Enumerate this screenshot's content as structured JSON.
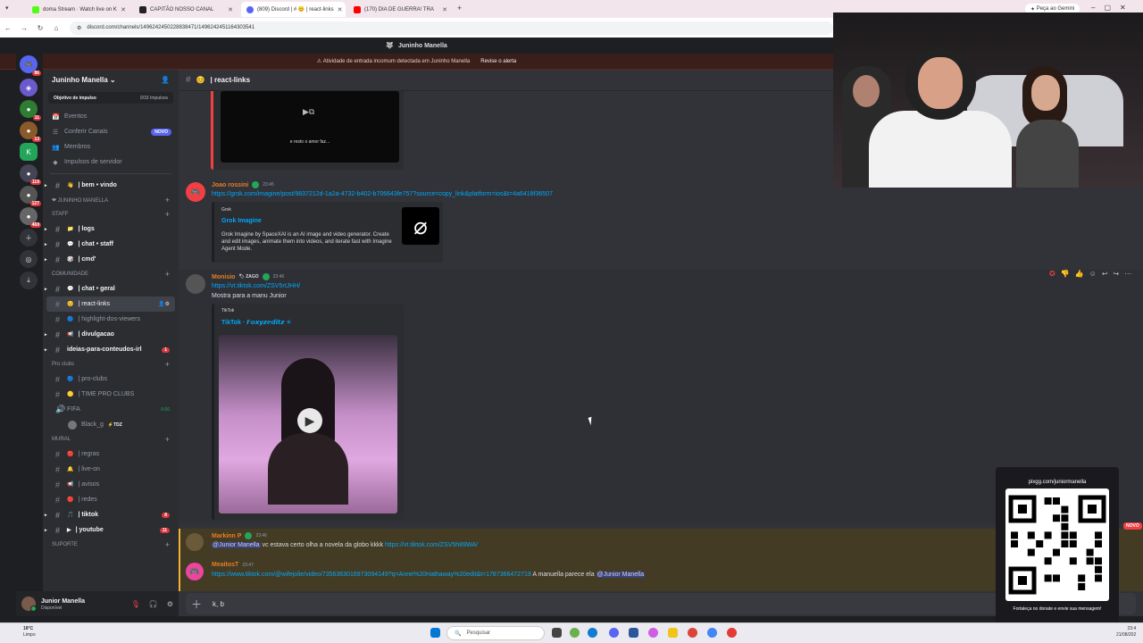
{
  "browser": {
    "tabs": [
      {
        "label": "doma Stream · Watch live on K",
        "active": false,
        "color": "#53fc18"
      },
      {
        "label": "CAPITÃO NOSSO CANAL",
        "active": false,
        "color": "#222222"
      },
      {
        "label": "(809) Discord | # 😊 | react-links",
        "active": true,
        "color": "#5865f2"
      },
      {
        "label": "(170) DIA DE GUERRA! TRA",
        "active": false,
        "color": "#ff0000"
      }
    ],
    "url": "discord.com/channels/1496242450228838471/1496242451164303541",
    "gemini_label": "Peça ao Gemini"
  },
  "discord": {
    "top_title": "Juninho Manella",
    "alert_text": "Atividade de entrada incomum detectada em Juninho Manella",
    "alert_link": "Revise o alerta",
    "server_badges": [
      "86",
      "11",
      "13",
      "119",
      "127",
      "469"
    ],
    "server_name": "Juninho Manella",
    "boost_label": "Objetivo de impulso",
    "boost_value": "0/33 Impulsos",
    "nav": [
      {
        "icon": "calendar-icon",
        "label": "Eventos"
      },
      {
        "icon": "channels-icon",
        "label": "Conferir Canais",
        "badge": "NOVO"
      },
      {
        "icon": "members-icon",
        "label": "Membros"
      },
      {
        "icon": "boost-icon",
        "label": "Impulsos de servidor"
      }
    ],
    "channel_list": [
      {
        "type": "ch",
        "emoji": "👋",
        "label": "| bem • vindo",
        "bright": true
      },
      {
        "type": "cat",
        "label": "❤ JUNINHO MANELLA"
      },
      {
        "type": "cat",
        "label": "STAFF"
      },
      {
        "type": "ch",
        "emoji": "📁",
        "label": "| logs",
        "bright": true
      },
      {
        "type": "ch",
        "emoji": "💬",
        "label": "| chat • staff",
        "bright": true
      },
      {
        "type": "ch",
        "emoji": "🎲",
        "label": "| cmd'",
        "bright": true
      },
      {
        "type": "cat",
        "label": "COMUNIDADE"
      },
      {
        "type": "ch",
        "emoji": "💬",
        "label": "| chat • geral",
        "bright": true
      },
      {
        "type": "ch",
        "emoji": "😊",
        "label": "| react-links",
        "selected": true
      },
      {
        "type": "ch",
        "emoji": "🔵",
        "label": "| highlight-dos-viewers"
      },
      {
        "type": "ch",
        "emoji": "📢",
        "label": "| divulgacao",
        "bright": true
      },
      {
        "type": "ch",
        "emoji": "",
        "label": "ideias-para-conteudos-irl",
        "bright": true,
        "badge": "1"
      },
      {
        "type": "cat",
        "label": "Pro clubs"
      },
      {
        "type": "ch",
        "emoji": "🔵",
        "label": "| pro-clubs"
      },
      {
        "type": "ch",
        "emoji": "🟡",
        "label": "| TIME PRO CLUBS"
      },
      {
        "type": "voice",
        "emoji": "🔊",
        "label": "FIFA",
        "right": "0:00"
      },
      {
        "type": "user",
        "label": "Black_g",
        "tag": "⚡TDZ"
      },
      {
        "type": "cat",
        "label": "MURAL"
      },
      {
        "type": "ch",
        "emoji": "🔴",
        "label": "| regras"
      },
      {
        "type": "ch",
        "emoji": "🔔",
        "label": "| live-on"
      },
      {
        "type": "ch",
        "emoji": "📢",
        "label": "| avisos"
      },
      {
        "type": "ch",
        "emoji": "🔴",
        "label": "| redes"
      },
      {
        "type": "ch",
        "emoji": "🎵",
        "label": "| tiktok",
        "bright": true,
        "badge": "8"
      },
      {
        "type": "ch",
        "emoji": "▶",
        "label": "| youtube",
        "bright": true,
        "badge": "11"
      },
      {
        "type": "cat",
        "label": "SUPORTE"
      }
    ],
    "user": {
      "name": "Junior Manella",
      "status": "Disponível"
    },
    "channel_header": "| react-links",
    "video1_caption": "e resto o amor faz...",
    "messages": {
      "m1": {
        "author": "Joao rossini",
        "time": "23:45",
        "link": "https://grok.com/imagine/post/9837212d-1a2a-4732-b402-b706643fe757?source=copy_link&platform=ios&t=4a6418f36507",
        "embed_provider": "Grok",
        "embed_title": "Grok Imagine",
        "embed_desc": "Grok Imagine by SpaceXAI is an AI image and video generator. Create and edit images, animate them into videos, and iterate fast with Imagine Agent Mode."
      },
      "m2": {
        "author": "Monisio",
        "tag": "ZAGO",
        "time": "23:46",
        "link": "https://vt.tiktok.com/ZSV5rtJHH/",
        "text": "Mostra para a manu Junior",
        "embed_provider": "TikTok",
        "embed_title": "TikTok · 𝙁𝙤𝙭𝙮𝙯𝙚𝙙𝙞𝙩𝙯 ✳"
      },
      "m3": {
        "author": "Markinn P",
        "time": "23:46",
        "mention": "@Junior Manella",
        "text": " vc estava certo olha a novela da globo kkkk ",
        "link": "https://vt.tiktok.com/ZSV5h89WA/"
      },
      "m4": {
        "author": "MeaitosT",
        "time": "23:47",
        "link": "https://www.tiktok.com/@wifejolie/video/7356363016973094149?q=Anne%20Hathaway%20edit&t=1787366472719",
        "text": " A manuella parece ela ",
        "mention": "@Junior Manella"
      }
    },
    "new_badge": "NOVO",
    "composer_text": "k, b"
  },
  "overlay": {
    "qr_url": "pixgg.com/juniormanella",
    "qr_caption": "Fortaleça no donate e envie sua mensagem!"
  },
  "taskbar": {
    "weather_temp": "18°C",
    "weather_desc": "Limpo",
    "search_placeholder": "Pesquisar",
    "time": "23:4",
    "date": "21/08/202"
  },
  "colors": {
    "accent": "#5865f2",
    "mention_bg": "#443b24",
    "danger": "#da373c",
    "link": "#00a8fc"
  }
}
